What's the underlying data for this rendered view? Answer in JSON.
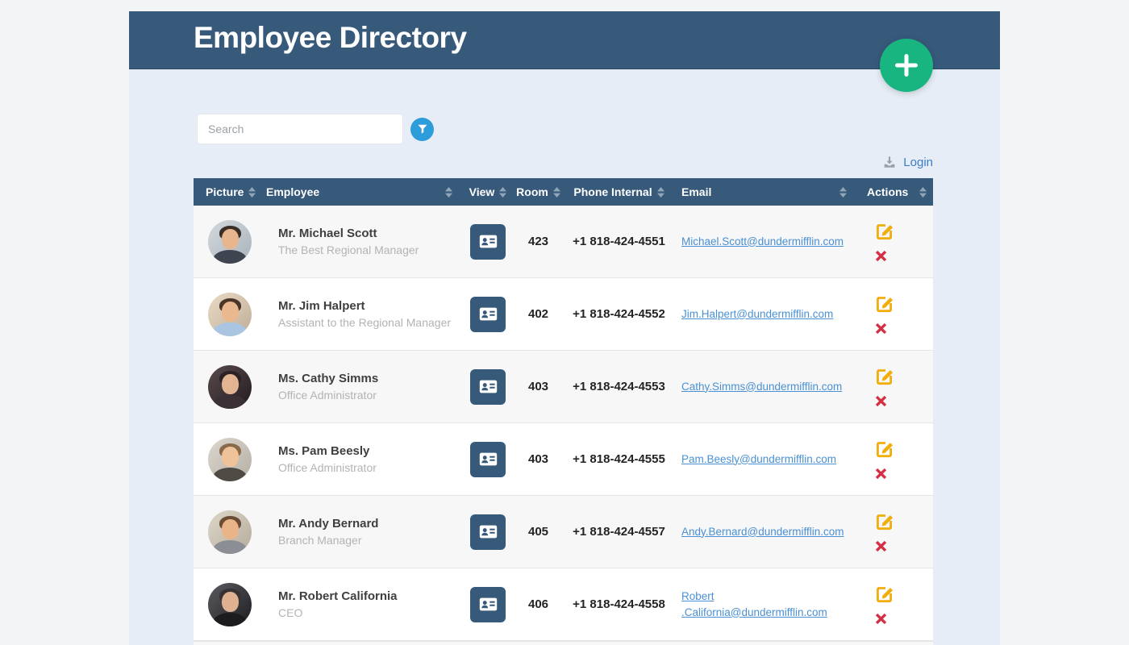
{
  "app": {
    "title": "Employee Directory"
  },
  "colors": {
    "header_bg": "#37597a",
    "content_bg": "#e7edf6",
    "page_bg": "#f2f4f6",
    "add_button_green": "#19b581",
    "filter_button_blue": "#2d9cdb",
    "email_link_blue": "#4a90d2",
    "login_link_blue": "#3d7cc9",
    "edit_icon_yellow": "#f0ad0d",
    "delete_icon_red": "#d62f44",
    "row_stripe": "#f7f7f7"
  },
  "search": {
    "placeholder": "Search"
  },
  "login": {
    "label": "Login"
  },
  "table": {
    "columns": [
      {
        "label": "Picture",
        "sortable": true
      },
      {
        "label": "Employee",
        "sortable": true
      },
      {
        "label": "View",
        "sortable": true
      },
      {
        "label": "Room",
        "sortable": true
      },
      {
        "label": "Phone Internal",
        "sortable": true
      },
      {
        "label": "Email",
        "sortable": true
      },
      {
        "label": "Actions",
        "sortable": true
      }
    ],
    "rows": [
      {
        "name": "Mr. Michael Scott",
        "title": "The Best Regional Manager",
        "room": "423",
        "phone": "+1 818-424-4551",
        "email": "Michael.Scott@dundermifflin.com",
        "avatar": {
          "bg1": "#d3d9dd",
          "bg2": "#aab3bb",
          "hair": "#3a2e28",
          "skin": "#e8b68e",
          "torso": "#3f4550"
        }
      },
      {
        "name": "Mr. Jim Halpert",
        "title": "Assistant to the Regional Manager",
        "room": "402",
        "phone": "+1 818-424-4552",
        "email": "Jim.Halpert@dundermifflin.com",
        "avatar": {
          "bg1": "#e9dac5",
          "bg2": "#bfae97",
          "hair": "#4a3526",
          "skin": "#eab88f",
          "torso": "#a9c5e1"
        }
      },
      {
        "name": "Ms. Cathy Simms",
        "title": "Office Administrator",
        "room": "403",
        "phone": "+1 818-424-4553",
        "email": "Cathy.Simms@dundermifflin.com",
        "avatar": {
          "bg1": "#594a4c",
          "bg2": "#221c20",
          "hair": "#2c2126",
          "skin": "#e3b492",
          "torso": "#3a3036"
        }
      },
      {
        "name": "Ms. Pam Beesly",
        "title": "Office Administrator",
        "room": "403",
        "phone": "+1 818-424-4555",
        "email": "Pam.Beesly@dundermifflin.com",
        "avatar": {
          "bg1": "#dcd7cf",
          "bg2": "#b5aea4",
          "hair": "#8a6a49",
          "skin": "#eec39a",
          "torso": "#4e4a44"
        }
      },
      {
        "name": "Mr. Andy Bernard",
        "title": "Branch Manager",
        "room": "405",
        "phone": "+1 818-424-4557",
        "email": "Andy.Bernard@dundermifflin.com",
        "avatar": {
          "bg1": "#ded7c9",
          "bg2": "#b4ab9b",
          "hair": "#6b4c34",
          "skin": "#e8b488",
          "torso": "#8b8e94"
        }
      },
      {
        "name": "Mr. Robert California",
        "title": "CEO",
        "room": "406",
        "phone": "+1 818-424-4558",
        "email": "Robert​.California@dundermifflin.com",
        "avatar": {
          "bg1": "#5c5c60",
          "bg2": "#1d1d21",
          "hair": "#393134",
          "skin": "#e0b191",
          "torso": "#1c1c1f"
        }
      }
    ]
  }
}
